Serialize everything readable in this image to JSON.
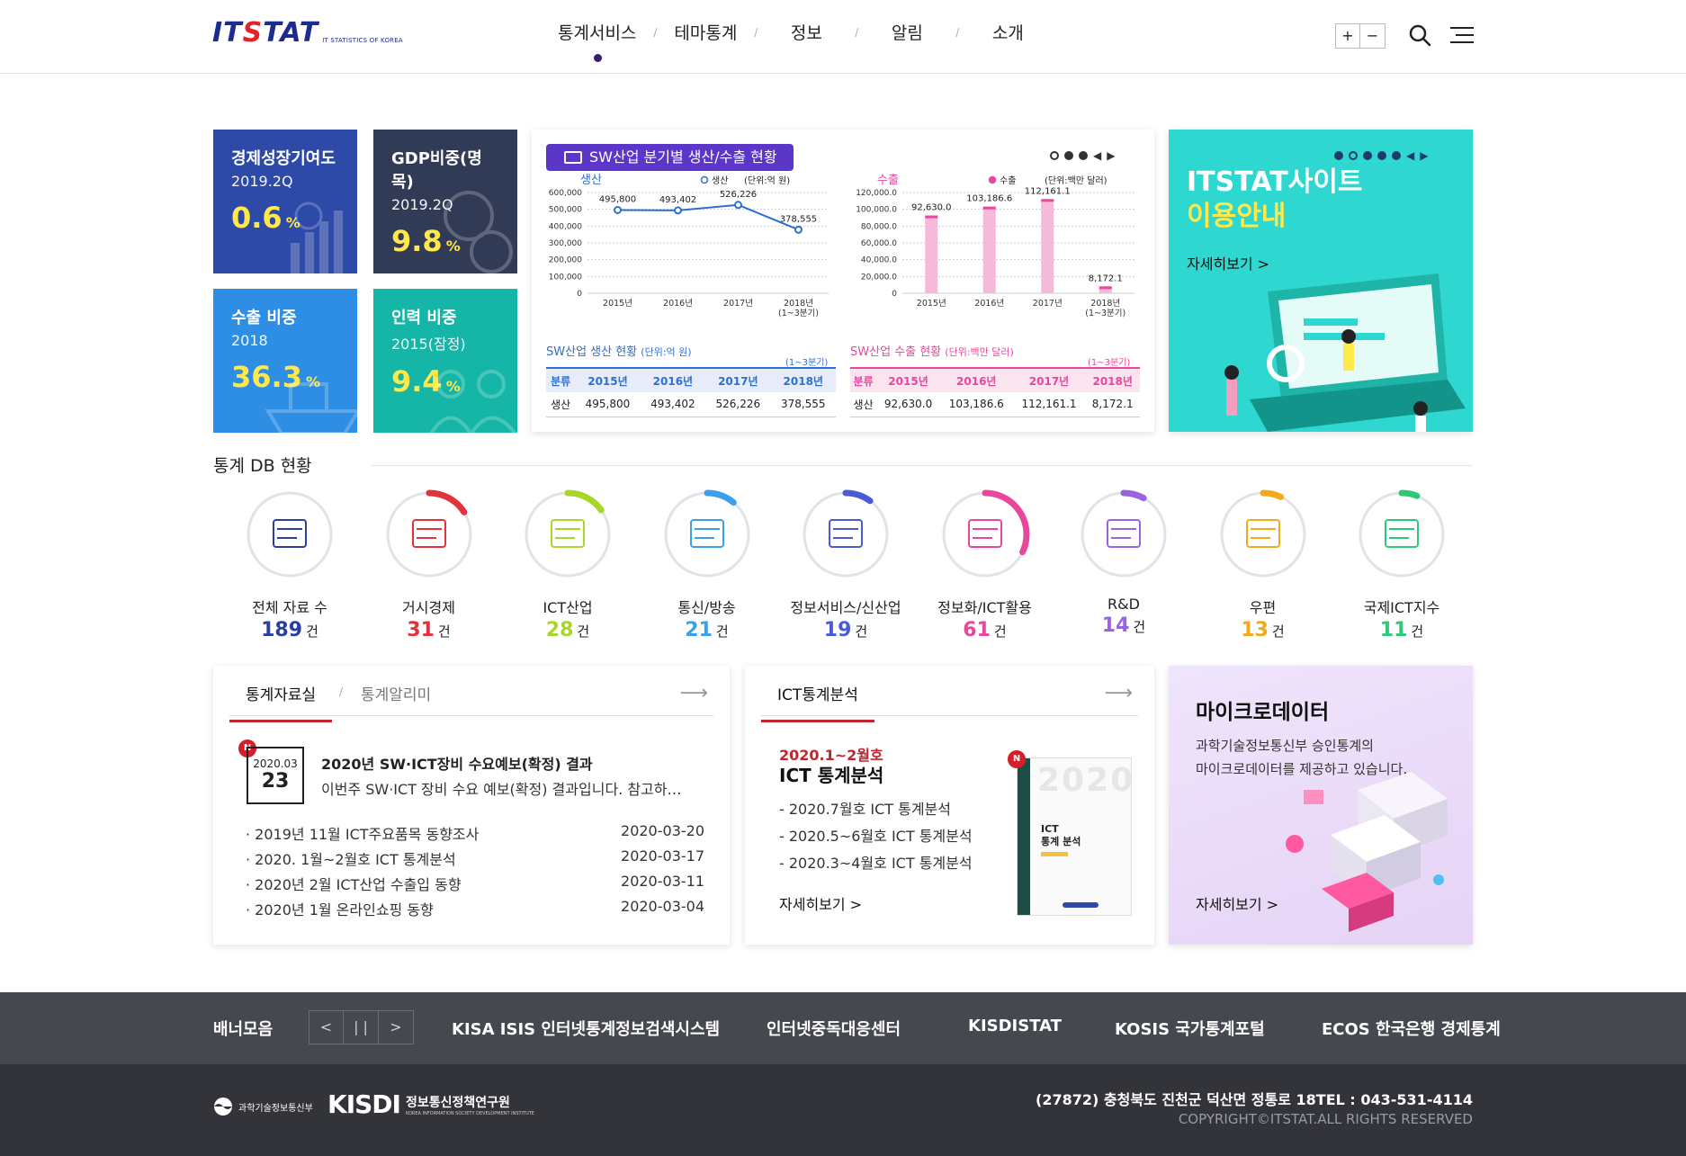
{
  "header": {
    "logo_text": "ITSTAT",
    "logo_subtext": "IT STATISTICS OF KOREA",
    "nav": [
      "통계서비스",
      "테마통계",
      "정보",
      "알림",
      "소개"
    ],
    "zoom_in": "+",
    "zoom_out": "−"
  },
  "stat_tiles": [
    {
      "title": "경제성장기여도",
      "period": "2019.2Q",
      "value": "0.6",
      "unit": "%",
      "color": "#2e4aa8"
    },
    {
      "title": "GDP비중(명목)",
      "period": "2019.2Q",
      "value": "9.8",
      "unit": "%",
      "color": "#323b56"
    },
    {
      "title": "수출 비중",
      "period": "2018",
      "value": "36.3",
      "unit": "%",
      "color": "#2e8ee4"
    },
    {
      "title": "인력 비중",
      "period": "2015(잠정)",
      "value": "9.4",
      "unit": "%",
      "color": "#15b6a7"
    }
  ],
  "sw_card": {
    "badge": "SW산업 분기별 생산/수출 현황",
    "production": {
      "label": "생산",
      "legend": "생산",
      "unit": "(단위:억 원)",
      "table_caption": "SW산업 생산 현황",
      "table_unit": "(단위:억 원)",
      "quarter_note": "(1~3분기)",
      "headers": [
        "분류",
        "2015년",
        "2016년",
        "2017년",
        "2018년"
      ],
      "row": [
        "생산",
        "495,800",
        "493,402",
        "526,226",
        "378,555"
      ]
    },
    "export": {
      "label": "수출",
      "legend": "수출",
      "unit": "(단위:백만 달러)",
      "table_caption": "SW산업 수출 현황",
      "table_unit": "(단위:백만 달러)",
      "quarter_note": "(1~3분기)",
      "headers": [
        "분류",
        "2015년",
        "2016년",
        "2017년",
        "2018년"
      ],
      "row": [
        "생산",
        "92,630.0",
        "103,186.6",
        "112,161.1",
        "8,172.1"
      ]
    }
  },
  "chart_data": [
    {
      "type": "line",
      "title": "생산",
      "ylabel": "(단위:억 원)",
      "categories": [
        "2015년",
        "2016년",
        "2017년",
        "2018년\n(1~3분기)"
      ],
      "series": [
        {
          "name": "생산",
          "values": [
            495800,
            493402,
            526226,
            378555
          ]
        }
      ],
      "data_labels": [
        "495,800",
        "493,402",
        "526,226",
        "378,555"
      ],
      "yticks": [
        "0",
        "100,000",
        "200,000",
        "300,000",
        "400,000",
        "500,000",
        "600,000"
      ],
      "ylim": [
        0,
        600000
      ],
      "color": "#2f6fd1"
    },
    {
      "type": "bar",
      "title": "수출",
      "ylabel": "(단위:백만 달러)",
      "categories": [
        "2015년",
        "2016년",
        "2017년",
        "2018년\n(1~3분기)"
      ],
      "series": [
        {
          "name": "수출",
          "values": [
            92630.0,
            103186.6,
            112161.1,
            8172.1
          ]
        }
      ],
      "data_labels": [
        "92,630.0",
        "103,186.6",
        "112,161.1",
        "8,172.1"
      ],
      "yticks": [
        "0",
        "20,000.0",
        "40,000.0",
        "60,000.0",
        "80,000.0",
        "100,000.0",
        "120,000.0"
      ],
      "ylim": [
        0,
        120000
      ],
      "color": "#e8479b"
    }
  ],
  "promo": {
    "title_line1": "ITSTAT사이트",
    "title_line2": "이용안내",
    "more": "자세히보기 >"
  },
  "db_section": {
    "title": "통계 DB 현황",
    "unit": "건",
    "items": [
      {
        "label": "전체 자료 수",
        "count": "189",
        "color": "#2b3f9c",
        "icon": "inbox-icon",
        "arc": 0
      },
      {
        "label": "거시경제",
        "count": "31",
        "color": "#e2333c",
        "icon": "money-icon",
        "arc": 0.16
      },
      {
        "label": "ICT산업",
        "count": "28",
        "color": "#a8d62a",
        "icon": "laptop-globe-icon",
        "arc": 0.15
      },
      {
        "label": "통신/방송",
        "count": "21",
        "color": "#3aa0ea",
        "icon": "smartphone-icon",
        "arc": 0.11
      },
      {
        "label": "정보서비스/신산업",
        "count": "19",
        "color": "#4a5bd8",
        "icon": "tv-icon",
        "arc": 0.1
      },
      {
        "label": "정보화/ICT활용",
        "count": "61",
        "color": "#e8479b",
        "icon": "monitor-download-icon",
        "arc": 0.32
      },
      {
        "label": "R&D",
        "count": "14",
        "color": "#9a63e0",
        "icon": "clipboard-icon",
        "arc": 0.08
      },
      {
        "label": "우편",
        "count": "13",
        "color": "#f2a91a",
        "icon": "envelope-icon",
        "arc": 0.07
      },
      {
        "label": "국제ICT지수",
        "count": "11",
        "color": "#2ec878",
        "icon": "globe-icon",
        "arc": 0.06
      }
    ]
  },
  "news": {
    "tab_active": "통계자료실",
    "tab_other": "통계알리미",
    "badge": "N",
    "featured_ym": "2020.03",
    "featured_day": "23",
    "featured_title": "2020년 SW·ICT장비 수요예보(확정) 결과",
    "featured_desc": "이번주 SW·ICT 장비 수요 예보(확정) 결과입니다. 참고하…",
    "items": [
      {
        "title": "· 2019년 11월 ICT주요품목 동향조사",
        "date": "2020-03-20"
      },
      {
        "title": "· 2020. 1월~2월호 ICT 통계분석",
        "date": "2020-03-17"
      },
      {
        "title": "· 2020년 2월 ICT산업 수출입 동향",
        "date": "2020-03-11"
      },
      {
        "title": "· 2020년 1월 온라인쇼핑 동향",
        "date": "2020-03-04"
      }
    ]
  },
  "ict": {
    "tab": "ICT통계분석",
    "date": "2020.1~2월호",
    "title": "ICT 통계분석",
    "badge": "N",
    "list": [
      "- 2020.7월호 ICT 통계분석",
      "- 2020.5~6월호 ICT 통계분석",
      "- 2020.3~4월호 ICT 통계분석"
    ],
    "more": "자세히보기 >",
    "book_title_line1": "ICT",
    "book_title_line2": "통계 분석",
    "book_year": "2020"
  },
  "micro": {
    "title": "마이크로데이터",
    "desc_line1": "과학기술정보통신부 승인통계의",
    "desc_line2": "마이크로데이터를 제공하고 있습니다.",
    "more": "자세히보기 >"
  },
  "banner": {
    "title": "배너모음",
    "prev": "<",
    "pause": "| |",
    "next": ">",
    "links": [
      "KISA ISIS 인터넷통계정보검색시스템",
      "인터넷중독대응센터",
      "KISDISTAT",
      "KOSIS 국가통계포털",
      "ECOS 한국은행 경제통계"
    ]
  },
  "footer": {
    "ministry": "과학기술정보통신부",
    "kisdi": "KISDI",
    "kisdi_name": "정보통신정책연구원",
    "kisdi_en": "KOREA INFORMATION SOCIETY DEVELOPMENT INSTITUTE",
    "address": "(27872) 충청북도 진천군 덕산면 정통로 18TEL : 043-531-4114",
    "copyright": "COPYRIGHT©ITSTAT.ALL RIGHTS RESERVED"
  }
}
